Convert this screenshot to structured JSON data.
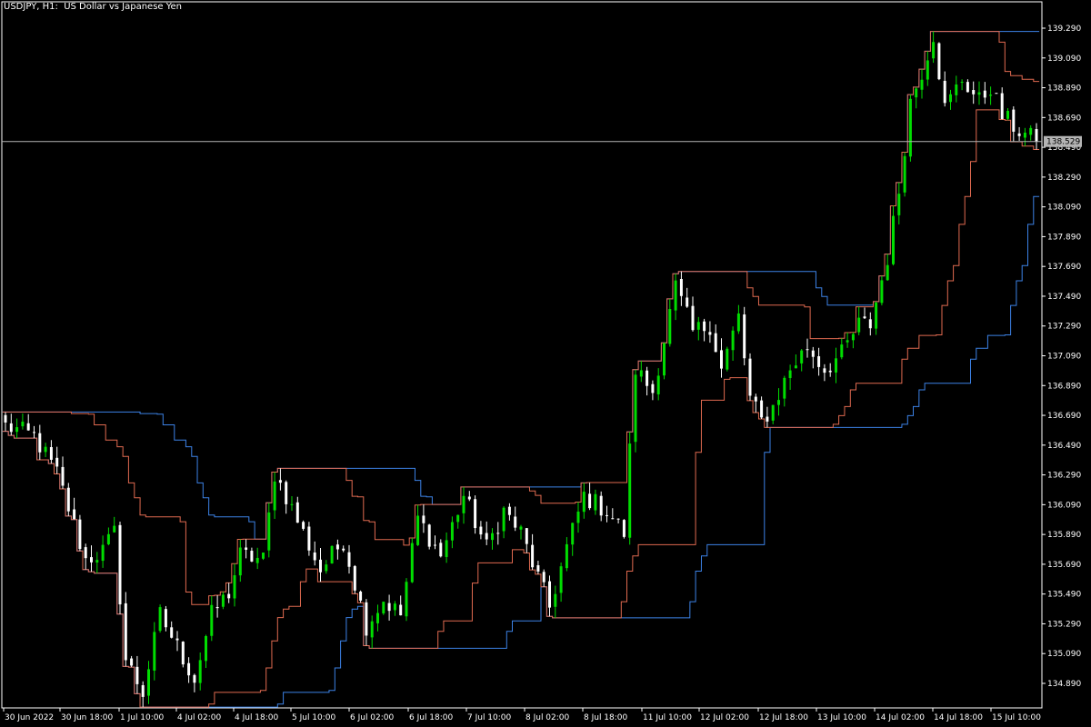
{
  "window": {
    "symbol": "USDJPY",
    "timeframe": "H1",
    "description": "US Dollar vs Japanese Yen",
    "title_text": "USDJPY, H1:  US Dollar vs Japanese Yen"
  },
  "colors": {
    "background": "#000000",
    "axis": "#ffffff",
    "bull_candle": "#00dd00",
    "bear_candle": "#ffffff",
    "outer_channel": "#3c82e6",
    "inner_channel": "#e06a50",
    "current_price_line": "#b4b4b4",
    "current_price_box": "#b4b4b4"
  },
  "chart_data": {
    "type": "candlestick",
    "title": "USDJPY, H1:  US Dollar vs Japanese Yen",
    "xlabel": "",
    "ylabel": "",
    "ylim": [
      134.7,
      139.4
    ],
    "grid": false,
    "y_ticks": [
      "139.290",
      "139.090",
      "138.890",
      "138.690",
      "138.490",
      "138.290",
      "138.090",
      "137.890",
      "137.690",
      "137.490",
      "137.290",
      "137.090",
      "136.890",
      "136.690",
      "136.490",
      "136.290",
      "136.090",
      "135.890",
      "135.690",
      "135.490",
      "135.290",
      "135.090",
      "134.890"
    ],
    "x_ticks": [
      "30 Jun 2022",
      "30 Jun 18:00",
      "1 Jul 10:00",
      "4 Jul 02:00",
      "4 Jul 18:00",
      "5 Jul 10:00",
      "6 Jul 02:00",
      "6 Jul 18:00",
      "7 Jul 10:00",
      "8 Jul 02:00",
      "8 Jul 18:00",
      "11 Jul 10:00",
      "12 Jul 02:00",
      "12 Jul 18:00",
      "13 Jul 10:00",
      "14 Jul 02:00",
      "14 Jul 18:00",
      "15 Jul 10:00"
    ],
    "current_price": 138.529,
    "current_price_label": "138.529",
    "path_anchors": [
      [
        0,
        136.62
      ],
      [
        5,
        136.55
      ],
      [
        9,
        136.3
      ],
      [
        14,
        135.72
      ],
      [
        17,
        135.78
      ],
      [
        19,
        135.9
      ],
      [
        21,
        135.05
      ],
      [
        24,
        134.83
      ],
      [
        27,
        135.35
      ],
      [
        33,
        134.92
      ],
      [
        36,
        135.35
      ],
      [
        39,
        135.5
      ],
      [
        41,
        135.75
      ],
      [
        45,
        135.72
      ],
      [
        47,
        136.3
      ],
      [
        49,
        136.15
      ],
      [
        52,
        135.9
      ],
      [
        55,
        135.65
      ],
      [
        59,
        135.85
      ],
      [
        63,
        135.28
      ],
      [
        66,
        135.45
      ],
      [
        69,
        135.35
      ],
      [
        72,
        136.0
      ],
      [
        76,
        135.75
      ],
      [
        80,
        136.15
      ],
      [
        84,
        135.8
      ],
      [
        87,
        136.05
      ],
      [
        90,
        135.9
      ],
      [
        93,
        135.6
      ],
      [
        95,
        135.4
      ],
      [
        98,
        135.8
      ],
      [
        101,
        136.15
      ],
      [
        103,
        136.1
      ],
      [
        105,
        136.05
      ],
      [
        108,
        135.9
      ],
      [
        110,
        137.0
      ],
      [
        113,
        136.85
      ],
      [
        115,
        137.2
      ],
      [
        117,
        137.55
      ],
      [
        120,
        137.25
      ],
      [
        123,
        137.3
      ],
      [
        125,
        137.0
      ],
      [
        128,
        137.35
      ],
      [
        130,
        136.8
      ],
      [
        132,
        136.65
      ],
      [
        134,
        136.75
      ],
      [
        137,
        137.0
      ],
      [
        140,
        137.15
      ],
      [
        143,
        137.0
      ],
      [
        146,
        137.1
      ],
      [
        149,
        137.3
      ],
      [
        151,
        137.3
      ],
      [
        154,
        137.75
      ],
      [
        156,
        138.2
      ],
      [
        158,
        138.8
      ],
      [
        160,
        139.0
      ],
      [
        162,
        139.25
      ],
      [
        164,
        138.75
      ],
      [
        167,
        138.95
      ],
      [
        170,
        138.8
      ],
      [
        172,
        138.9
      ],
      [
        174,
        138.7
      ],
      [
        177,
        138.6
      ],
      [
        180,
        138.53
      ]
    ]
  }
}
